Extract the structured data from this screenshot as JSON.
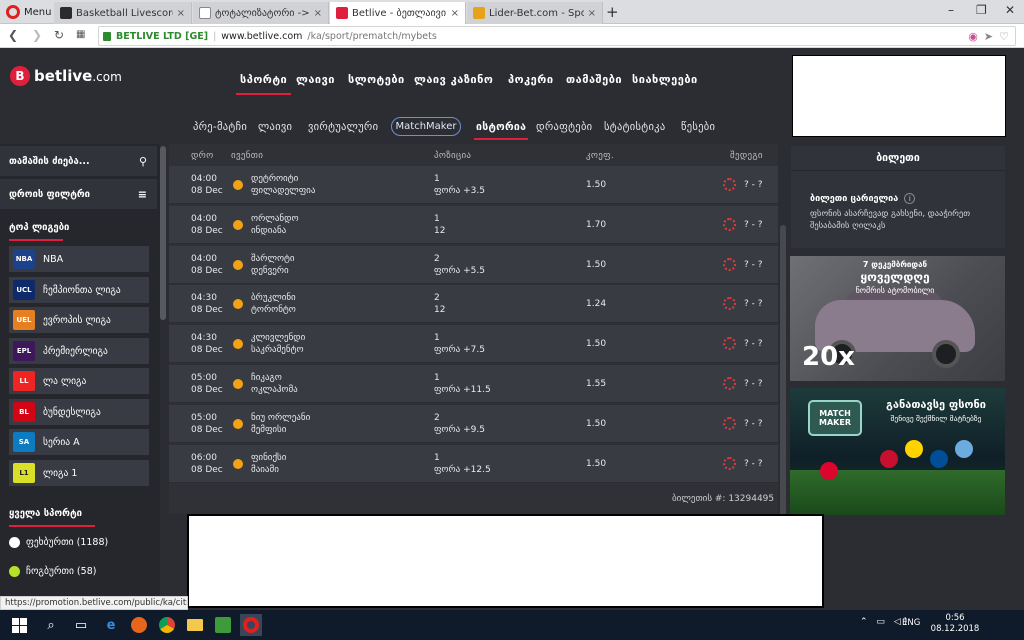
{
  "browser": {
    "menu_label": "Menu",
    "tabs": [
      {
        "label": "Basketball Livescore - Live",
        "close": "×",
        "favicon_color": "#2b2b2b"
      },
      {
        "label": "ტოტალიზატორი -> თბ",
        "close": "×",
        "favicon_color": "#ffffff"
      },
      {
        "label": "Betlive - ბეთლაივი - სპ",
        "close": "×",
        "favicon_color": "#e01f3d"
      },
      {
        "label": "Lider-Bet.com - Sports and",
        "close": "×",
        "favicon_color": "#e5a21b"
      }
    ],
    "new_tab": "+",
    "window_controls": {
      "minimize": "–",
      "restore": "❐",
      "close": "✕"
    },
    "url": {
      "secure_label": "BETLIVE LTD [GE]",
      "domain": "www.betlive.com",
      "path": "/ka/sport/prematch/mybets"
    },
    "status_url": "https://promotion.betlive.com/public/ka/citr"
  },
  "header": {
    "logo_text": "betlive",
    "logo_suffix": ".com",
    "main_nav": [
      "სპორტი",
      "ლაივი",
      "სლოტები",
      "ლაივ კაზინო",
      "პოკერი",
      "თამაშები",
      "სიახლეები"
    ],
    "sub_nav": [
      "პრე-მატჩი",
      "ლაივი",
      "ვირტუალური",
      "MatchMaker",
      "ისტორია",
      "დრაფტები",
      "სტატისტიკა",
      "წესები"
    ]
  },
  "sidebar": {
    "search_label": "თამაშის ძიება...",
    "time_filter_label": "დროის ფილტრი",
    "top_leagues_heading": "ტოპ ლიგები",
    "leagues": [
      {
        "label": "NBA",
        "badge": "NBA",
        "color": "#1d428a"
      },
      {
        "label": "ჩემპიონთა ლიგა",
        "badge": "UCL",
        "color": "#0e2a6b"
      },
      {
        "label": "ევროპის ლიგა",
        "badge": "UEL",
        "color": "#e67e22"
      },
      {
        "label": "პრემიერლიგა",
        "badge": "EPL",
        "color": "#3d195b"
      },
      {
        "label": "ლა ლიგა",
        "badge": "LL",
        "color": "#ee2523"
      },
      {
        "label": "ბუნდესლიგა",
        "badge": "BL",
        "color": "#d20515"
      },
      {
        "label": "სერია A",
        "badge": "SA",
        "color": "#0c7bc0"
      },
      {
        "label": "ლიგა 1",
        "badge": "L1",
        "color": "#dae025"
      }
    ],
    "all_sports_heading": "ყველა სპორტი",
    "sports": [
      {
        "label": "ფეხბურთი (1188)",
        "color": "#ffffff"
      },
      {
        "label": "ჩოგბურთი (58)",
        "color": "#b6e02a"
      }
    ]
  },
  "bets": {
    "columns": {
      "time": "დრო",
      "event": "ივენთი",
      "position": "პოზიცია",
      "odds": "კოეფ.",
      "result": "შედეგი"
    },
    "rows": [
      {
        "time": "04:00",
        "date": "08 Dec",
        "team1": "დეტროიტი",
        "team2": "ფილადელფია",
        "pick": "1",
        "pick_detail": "ფორა +3.5",
        "odds": "1.50",
        "score": "? - ?"
      },
      {
        "time": "04:00",
        "date": "08 Dec",
        "team1": "ორლანდო",
        "team2": "ინდიანა",
        "pick": "1",
        "pick_detail": "12",
        "odds": "1.70",
        "score": "? - ?"
      },
      {
        "time": "04:00",
        "date": "08 Dec",
        "team1": "შარლოტი",
        "team2": "დენვერი",
        "pick": "2",
        "pick_detail": "ფორა +5.5",
        "odds": "1.50",
        "score": "? - ?"
      },
      {
        "time": "04:30",
        "date": "08 Dec",
        "team1": "ბრუკლინი",
        "team2": "ტორონტო",
        "pick": "2",
        "pick_detail": "12",
        "odds": "1.24",
        "score": "? - ?"
      },
      {
        "time": "04:30",
        "date": "08 Dec",
        "team1": "კლივლენდი",
        "team2": "საკრამენტო",
        "pick": "1",
        "pick_detail": "ფორა +7.5",
        "odds": "1.50",
        "score": "? - ?"
      },
      {
        "time": "05:00",
        "date": "08 Dec",
        "team1": "ჩიკაგო",
        "team2": "ოკლაჰომა",
        "pick": "1",
        "pick_detail": "ფორა +11.5",
        "odds": "1.55",
        "score": "? - ?"
      },
      {
        "time": "05:00",
        "date": "08 Dec",
        "team1": "ნიუ ორლეანი",
        "team2": "მემფისი",
        "pick": "2",
        "pick_detail": "ფორა +9.5",
        "odds": "1.50",
        "score": "? - ?"
      },
      {
        "time": "06:00",
        "date": "08 Dec",
        "team1": "ფინიქსი",
        "team2": "მაიამი",
        "pick": "1",
        "pick_detail": "ფორა +12.5",
        "odds": "1.50",
        "score": "? - ?"
      }
    ],
    "ticket_number": "ბილეთის #: 13294495"
  },
  "ticket_panel": {
    "title": "ბილეთი",
    "empty_title": "ბილეთი ცარიელია",
    "info_glyph": "i",
    "description": "ფსონის ასარჩევად გახსენი, დააჭირეთ შესაბამის ღილაკს"
  },
  "promos": {
    "car": {
      "line1": "7 დეკემბრიდან",
      "line2": "ყოველდღე",
      "line3": "ნომრის ატომობილი",
      "multiplier": "20x"
    },
    "matchmaker": {
      "badge": "MATCH MAKER",
      "title": "განათავსე ფსონი",
      "subtitle": "შენივე შექმნილ მატჩებზე"
    }
  },
  "taskbar": {
    "search_glyph": "⌕",
    "view_glyph": "▭",
    "tray_icons": "⌃ ▭ ◁)",
    "lang": "ENG",
    "time": "0:56",
    "date": "08.12.2018"
  }
}
